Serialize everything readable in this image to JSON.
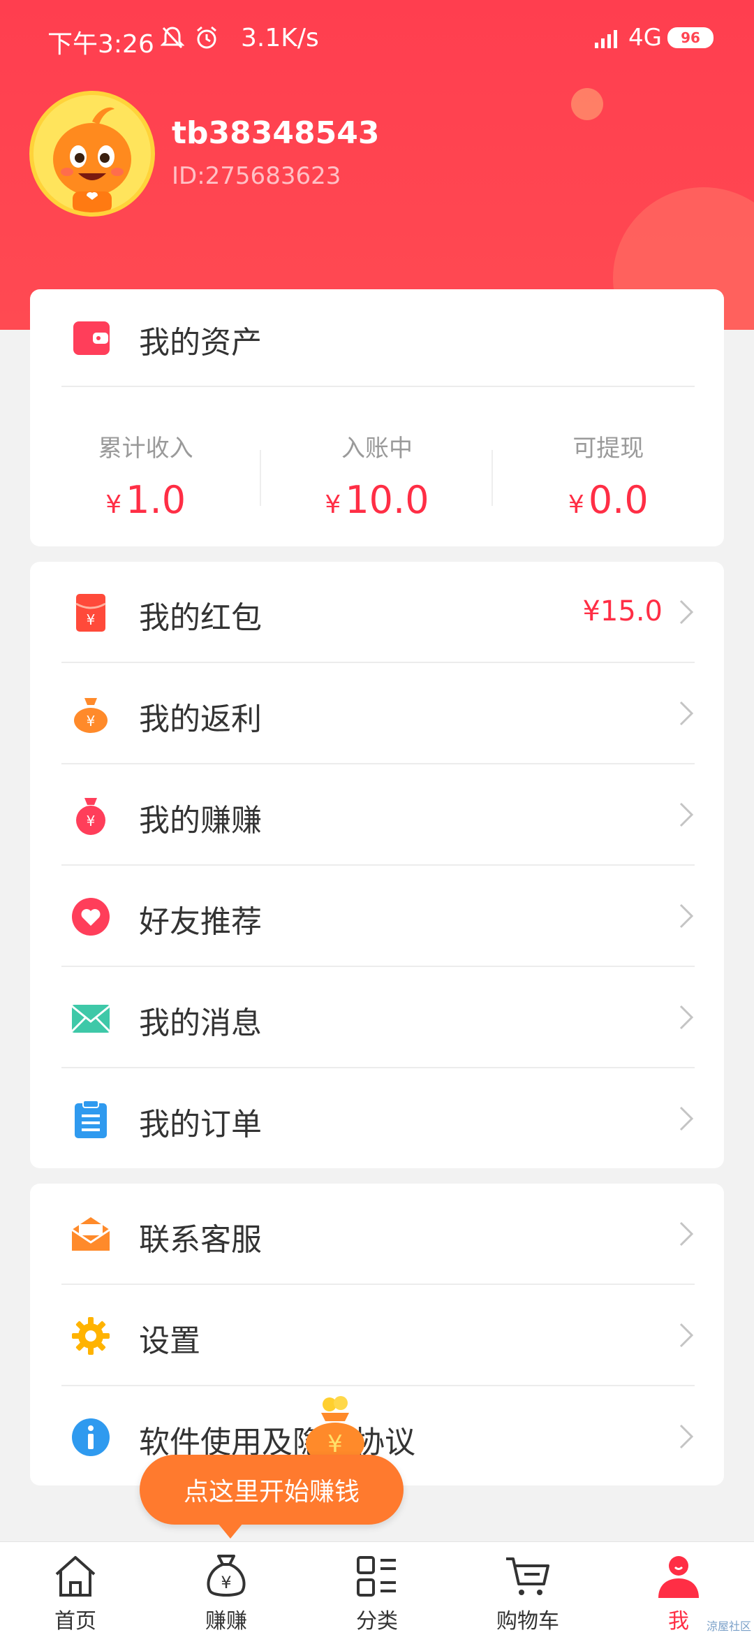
{
  "status_bar": {
    "time": "下午3:26",
    "speed": "3.1K/s",
    "network": "4G",
    "battery": "96"
  },
  "profile": {
    "username": "tb38348543",
    "user_id": "ID:275683623"
  },
  "assets": {
    "title": "我的资产",
    "items": [
      {
        "label": "累计收入",
        "currency": "¥",
        "value": "1.0"
      },
      {
        "label": "入账中",
        "currency": "¥",
        "value": "10.0"
      },
      {
        "label": "可提现",
        "currency": "¥",
        "value": "0.0"
      }
    ]
  },
  "menu": {
    "red_packet": {
      "label": "我的红包",
      "value": "¥15.0"
    },
    "rebate": {
      "label": "我的返利"
    },
    "earnings": {
      "label": "我的赚赚"
    },
    "referral": {
      "label": "好友推荐"
    },
    "messages": {
      "label": "我的消息"
    },
    "orders": {
      "label": "我的订单"
    },
    "support": {
      "label": "联系客服"
    },
    "settings": {
      "label": "设置"
    },
    "agreement": {
      "label": "软件使用及隐私协议"
    }
  },
  "tooltip": {
    "text": "点这里开始赚钱"
  },
  "tabbar": {
    "items": [
      {
        "label": "首页"
      },
      {
        "label": "赚赚"
      },
      {
        "label": "分类"
      },
      {
        "label": "购物车"
      },
      {
        "label": "我"
      }
    ]
  },
  "watermark": "涼屋社区",
  "colors": {
    "brand_red": "#ff3e4f",
    "accent_orange": "#ff7a2e",
    "price_red": "#ff2e45"
  }
}
